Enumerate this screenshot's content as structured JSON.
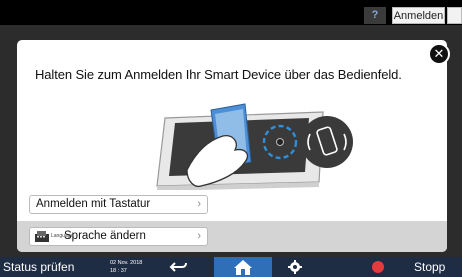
{
  "topbar": {
    "help_label": "?",
    "login_label": "Anmelden"
  },
  "dialog": {
    "message": "Halten Sie zum Anmelden Ihr Smart Device über das Bedienfeld.",
    "close_glyph": "✕",
    "keyboard_login_label": "Anmelden mit Tastatur",
    "language_small_label": "Language",
    "language_change_label": "Sprache ändern",
    "chevron_glyph": "›"
  },
  "bottombar": {
    "status_label": "Status prüfen",
    "date": "02 Nov. 2018",
    "time": "18 : 37",
    "stop_label": "Stopp"
  },
  "icons": [
    "help-icon",
    "close-icon",
    "keyboard-icon",
    "chevron-right-icon",
    "back-icon",
    "home-icon",
    "settings-icon",
    "stop-icon",
    "nfc-icon",
    "smartphone-icon"
  ],
  "colors": {
    "home_button": "#2f6fb7",
    "bottom_bar": "#1f2d44",
    "stop": "#e23b3b",
    "nfc_ring": "#2f8fd8"
  }
}
